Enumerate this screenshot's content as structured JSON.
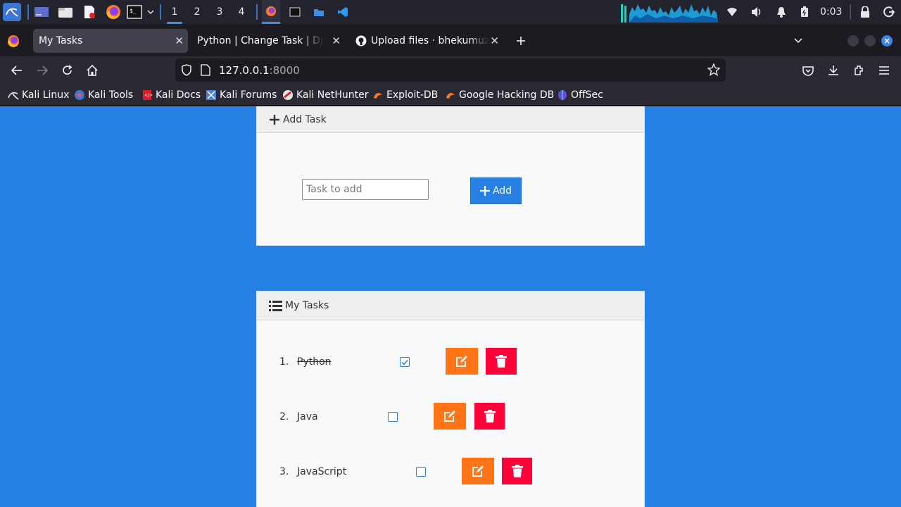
{
  "panel": {
    "workspaces": [
      "1",
      "2",
      "3",
      "4"
    ],
    "active_workspace": "1",
    "clock": "0:03",
    "icons": [
      "kali-menu-icon",
      "desktop-icon",
      "file-manager-icon",
      "text-editor-icon",
      "firefox-icon",
      "terminal-icon",
      "chevron-down-icon"
    ]
  },
  "browser": {
    "tabs": [
      {
        "title": "My Tasks",
        "active": true
      },
      {
        "title": "Python | Change Task | Django",
        "active": false
      },
      {
        "title": "Upload files · bhekumuzitl",
        "active": false
      }
    ],
    "url_host": "127.0.0.1",
    "url_port": ":8000",
    "bookmarks": [
      "Kali Linux",
      "Kali Tools",
      "Kali Docs",
      "Kali Forums",
      "Kali NetHunter",
      "Exploit-DB",
      "Google Hacking DB",
      "OffSec"
    ]
  },
  "add_card": {
    "header": "Add Task",
    "input_placeholder": "Task to add",
    "button_label": "Add"
  },
  "tasks_card": {
    "header": "My Tasks",
    "tasks": [
      {
        "num": "1.",
        "name": "Python",
        "done": true
      },
      {
        "num": "2.",
        "name": "Java",
        "done": false
      },
      {
        "num": "3.",
        "name": "JavaScript",
        "done": false
      }
    ]
  },
  "colors": {
    "page_bg": "#2780e3",
    "edit_button": "#ff7518",
    "delete_button": "#ff0039",
    "primary": "#2780e3"
  }
}
